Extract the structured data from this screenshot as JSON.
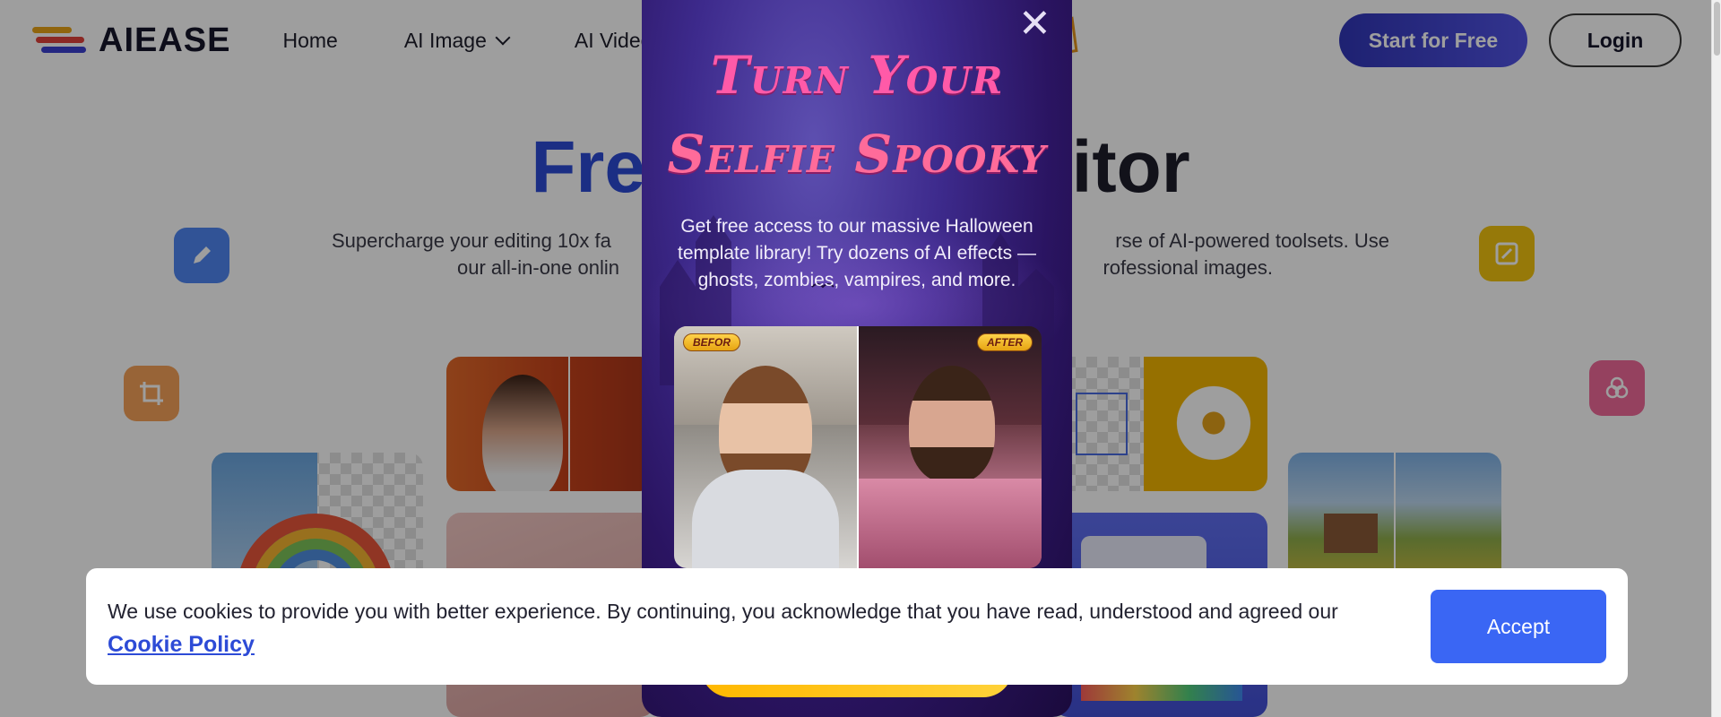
{
  "header": {
    "logo_text": "AIEASE",
    "nav": [
      {
        "label": "Home"
      },
      {
        "label": "AI Image"
      },
      {
        "label": "AI Video"
      }
    ],
    "start_label": "Start for Free",
    "login_label": "Login"
  },
  "hero": {
    "title_visible_left": "Free",
    "title_visible_right": "itor",
    "subtitle_line1": "Supercharge your editing 10x fa",
    "subtitle_line1_right": "rse of AI-powered toolsets. Use",
    "subtitle_line2": "our all-in-one onlin",
    "subtitle_line2_right": "rofessional images."
  },
  "promo": {
    "title_line1": "Turn Your",
    "title_line2": "Selfie Spooky",
    "body": "Get free access to our massive Halloween template library! Try dozens of AI effects — ghosts, zombies, vampires, and more.",
    "before_label": "BEFOR",
    "after_label": "AFTER",
    "close_glyph": "✕"
  },
  "cookie": {
    "text": "We use cookies to provide you with better experience. By continuing, you acknowledge that you have read, understood and agreed our",
    "link_label": "Cookie Policy",
    "accept_label": "Accept"
  },
  "colors": {
    "brand_blue": "#2d4bd6",
    "start_button": "#3136b8",
    "accept_button": "#3a66f4",
    "promo_pink": "#ff5aa8",
    "promo_cta": "#ffb800"
  },
  "icons": [
    "pencil-icon",
    "crop-icon",
    "chevron-down-icon",
    "close-icon",
    "image-edit-icon",
    "circles-icon"
  ]
}
